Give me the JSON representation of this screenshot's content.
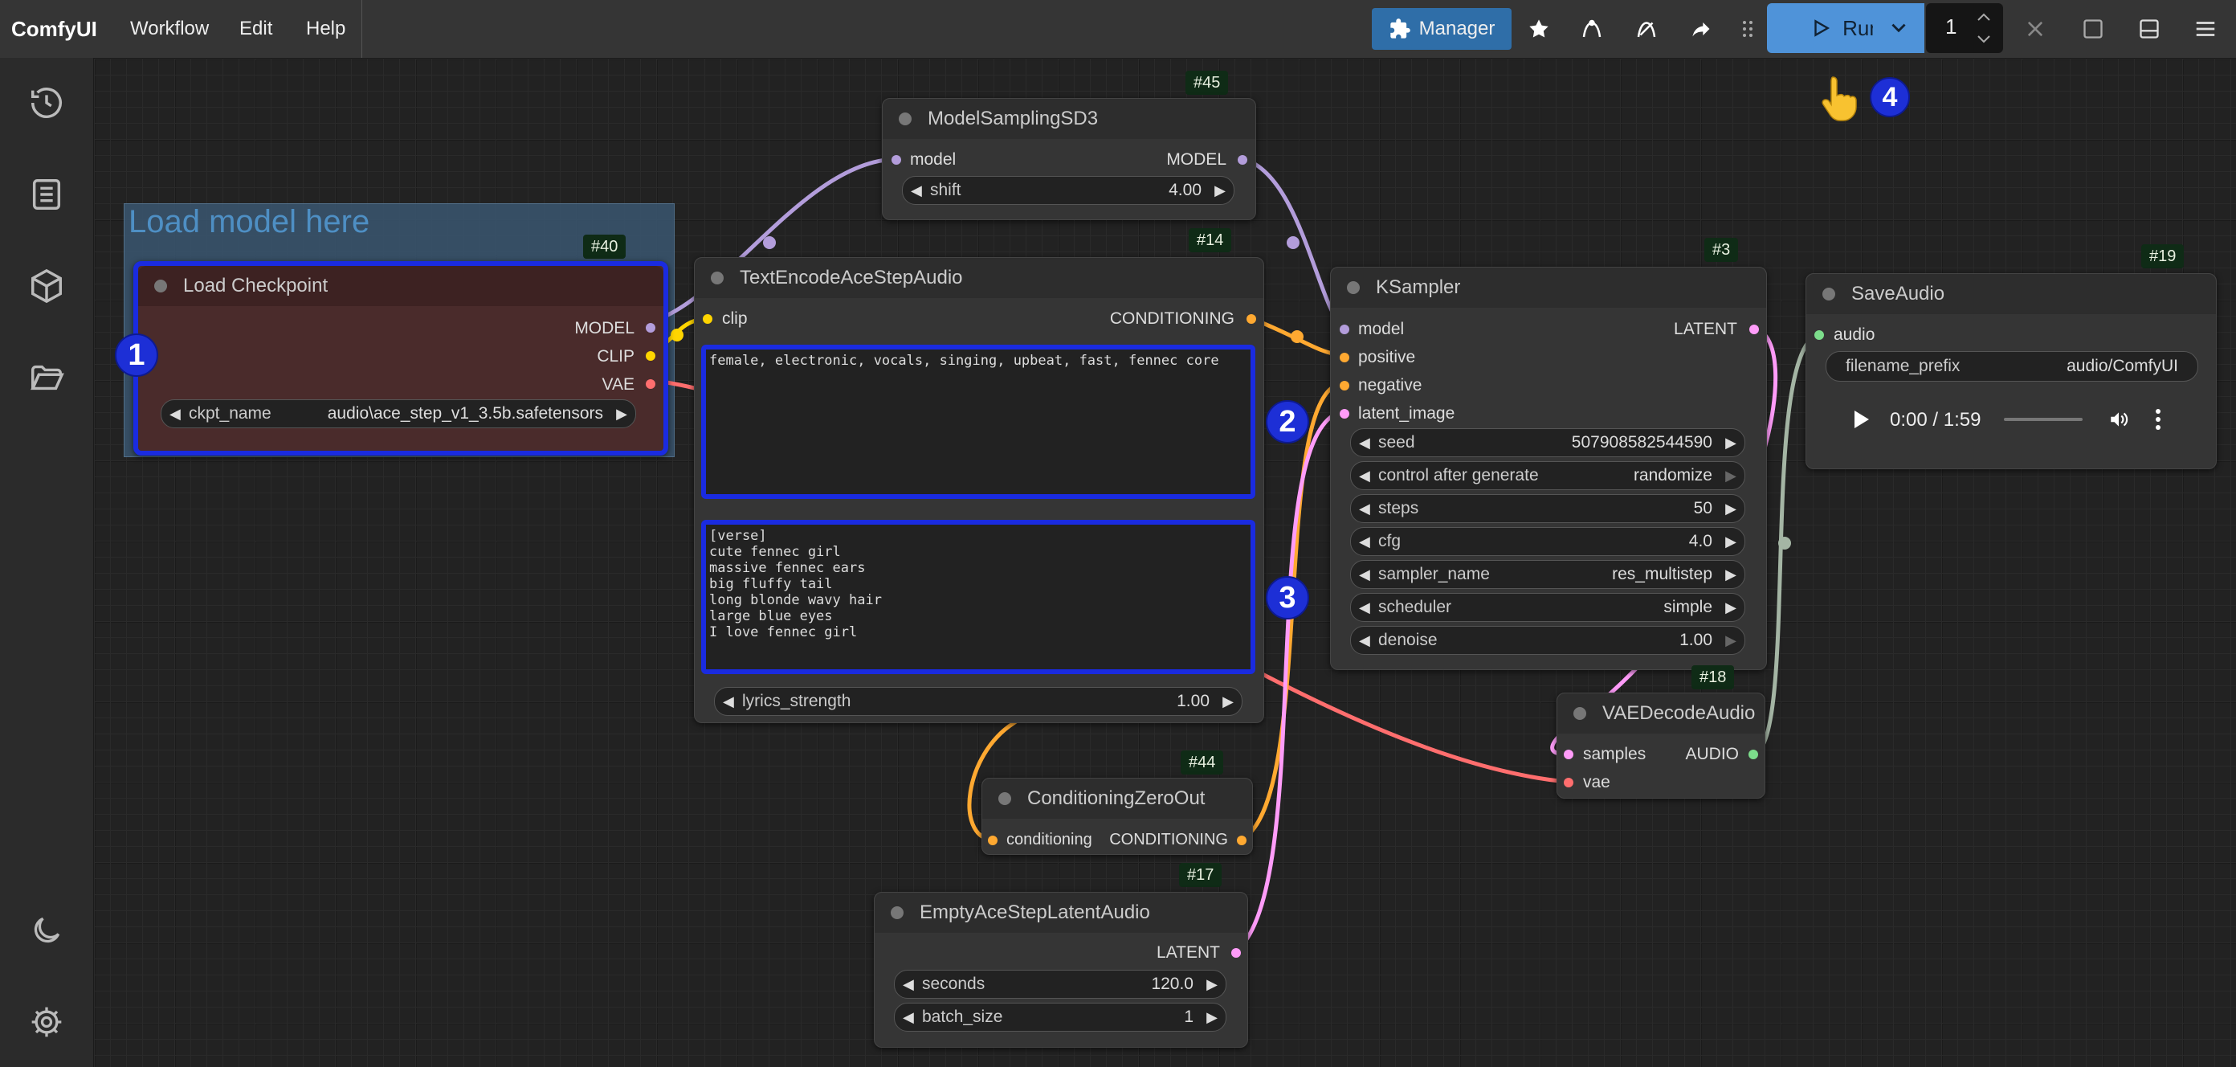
{
  "app": {
    "brand": "ComfyUI"
  },
  "menu": {
    "workflow": "Workflow",
    "edit": "Edit",
    "help": "Help"
  },
  "toolbar": {
    "manager_label": "Manager",
    "run_label": "Run",
    "queue_count": "1"
  },
  "group": {
    "title": "Load model here"
  },
  "markers": {
    "m1": "1",
    "m2": "2",
    "m3": "3",
    "m4": "4"
  },
  "nodes": {
    "load_checkpoint": {
      "title": "Load Checkpoint",
      "badge": "#40",
      "out_model": "MODEL",
      "out_clip": "CLIP",
      "out_vae": "VAE",
      "ckpt_label": "ckpt_name",
      "ckpt_value": "audio\\ace_step_v1_3.5b.safetensors"
    },
    "model_sampling": {
      "title": "ModelSamplingSD3",
      "badge": "#45",
      "in_model": "model",
      "out_model": "MODEL",
      "shift_label": "shift",
      "shift_value": "4.00"
    },
    "text_encode": {
      "title": "TextEncodeAceStepAudio",
      "badge": "#14",
      "in_clip": "clip",
      "out_conditioning": "CONDITIONING",
      "tags": "female, electronic, vocals, singing, upbeat, fast, fennec core",
      "lyrics": "[verse]\ncute fennec girl\nmassive fennec ears\nbig fluffy tail\nlong blonde wavy hair\nlarge blue eyes\nI love fennec girl",
      "lyrics_strength_label": "lyrics_strength",
      "lyrics_strength_value": "1.00"
    },
    "ksampler": {
      "title": "KSampler",
      "badge": "#3",
      "in_model": "model",
      "in_positive": "positive",
      "in_negative": "negative",
      "in_latent": "latent_image",
      "out_latent": "LATENT",
      "widgets": [
        {
          "label": "seed",
          "value": "507908582544590"
        },
        {
          "label": "control after generate",
          "value": "randomize"
        },
        {
          "label": "steps",
          "value": "50"
        },
        {
          "label": "cfg",
          "value": "4.0"
        },
        {
          "label": "sampler_name",
          "value": "res_multistep"
        },
        {
          "label": "scheduler",
          "value": "simple"
        },
        {
          "label": "denoise",
          "value": "1.00"
        }
      ]
    },
    "save_audio": {
      "title": "SaveAudio",
      "badge": "#19",
      "in_audio": "audio",
      "prefix_label": "filename_prefix",
      "prefix_value": "audio/ComfyUI",
      "time": "0:00 / 1:59"
    },
    "vae_decode": {
      "title": "VAEDecodeAudio",
      "badge": "#18",
      "in_samples": "samples",
      "in_vae": "vae",
      "out_audio": "AUDIO"
    },
    "cond_zero": {
      "title": "ConditioningZeroOut",
      "badge": "#44",
      "in_conditioning": "conditioning",
      "out_conditioning": "CONDITIONING"
    },
    "empty_latent": {
      "title": "EmptyAceStepLatentAudio",
      "badge": "#17",
      "out_latent": "LATENT",
      "seconds_label": "seconds",
      "seconds_value": "120.0",
      "batch_label": "batch_size",
      "batch_value": "1"
    }
  },
  "colors": {
    "model": "#b39ddb",
    "clip": "#ffd500",
    "vae": "#ff6e6e",
    "conditioning": "#ffa931",
    "latent": "#ff9cf9",
    "audio": "#7cdd8b",
    "accent": "#1d2fd6",
    "run": "#4f93d9",
    "manager": "#2f6ea8"
  }
}
